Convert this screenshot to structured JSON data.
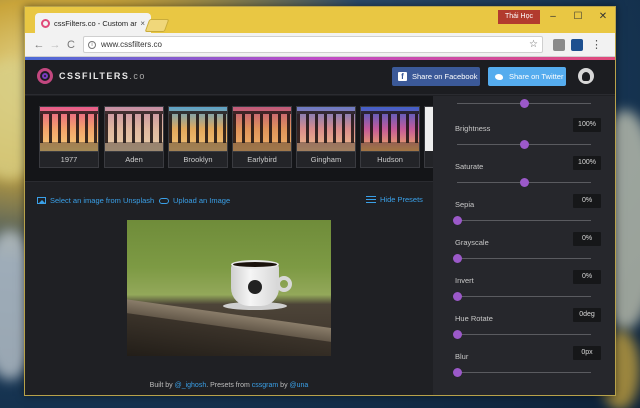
{
  "browser": {
    "tab_title": "cssFilters.co - Custom an",
    "tab_close": "×",
    "profile_name": "Thái Học",
    "url": "www.cssfilters.co",
    "window_controls": {
      "minimize": "–",
      "maximize": "☐",
      "close": "✕"
    },
    "nav": {
      "back": "←",
      "forward": "→",
      "reload": "C"
    }
  },
  "site": {
    "logo_text": "CSSFILTERS",
    "logo_suffix": ".co",
    "share_facebook": "Share on Facebook",
    "share_twitter": "Share on Twitter",
    "brand_colors": {
      "facebook": "#3b5998",
      "twitter": "#55acee",
      "accent": "#9b59c9",
      "link": "#3aa0e8"
    }
  },
  "presets": [
    {
      "name": "1977",
      "tint": "linear-gradient(180deg,#e65b8a,#f3a36b 50%,#f6d07a)"
    },
    {
      "name": "Aden",
      "tint": "linear-gradient(180deg,#c58ea3,#e0b8a0 50%,#e8cfa8)"
    },
    {
      "name": "Brooklyn",
      "tint": "linear-gradient(180deg,#5aa2c8,#e3a85c 50%,#f2c47a)"
    },
    {
      "name": "Earlybird",
      "tint": "linear-gradient(180deg,#c0597b,#e0935a 50%,#f0b46a)"
    },
    {
      "name": "Gingham",
      "tint": "linear-gradient(180deg,#6a79c4,#d98c8c 50%,#f0c08a)"
    },
    {
      "name": "Hudson",
      "tint": "linear-gradient(180deg,#3f5fc8,#c45a9a 50%,#f3b15e)"
    }
  ],
  "actions": {
    "select_unsplash": "Select an image from Unsplash",
    "upload_image": "Upload an Image",
    "hide_presets": "Hide Presets"
  },
  "footer": {
    "built_by": "Built by",
    "author": "@_ighosh",
    "presets_from": ". Presets from",
    "source": "cssgram",
    "by": "by",
    "source_author": "@una"
  },
  "controls": [
    {
      "label": "Brightness",
      "value": "100%",
      "level": 0.5
    },
    {
      "label": "Saturate",
      "value": "100%",
      "level": 0.5
    },
    {
      "label": "Sepia",
      "value": "0%",
      "level": 0
    },
    {
      "label": "Grayscale",
      "value": "0%",
      "level": 0
    },
    {
      "label": "Invert",
      "value": "0%",
      "level": 0
    },
    {
      "label": "Hue Rotate",
      "value": "0deg",
      "level": 0
    },
    {
      "label": "Blur",
      "value": "0px",
      "level": 0
    }
  ],
  "top_slider_level": 0.5
}
